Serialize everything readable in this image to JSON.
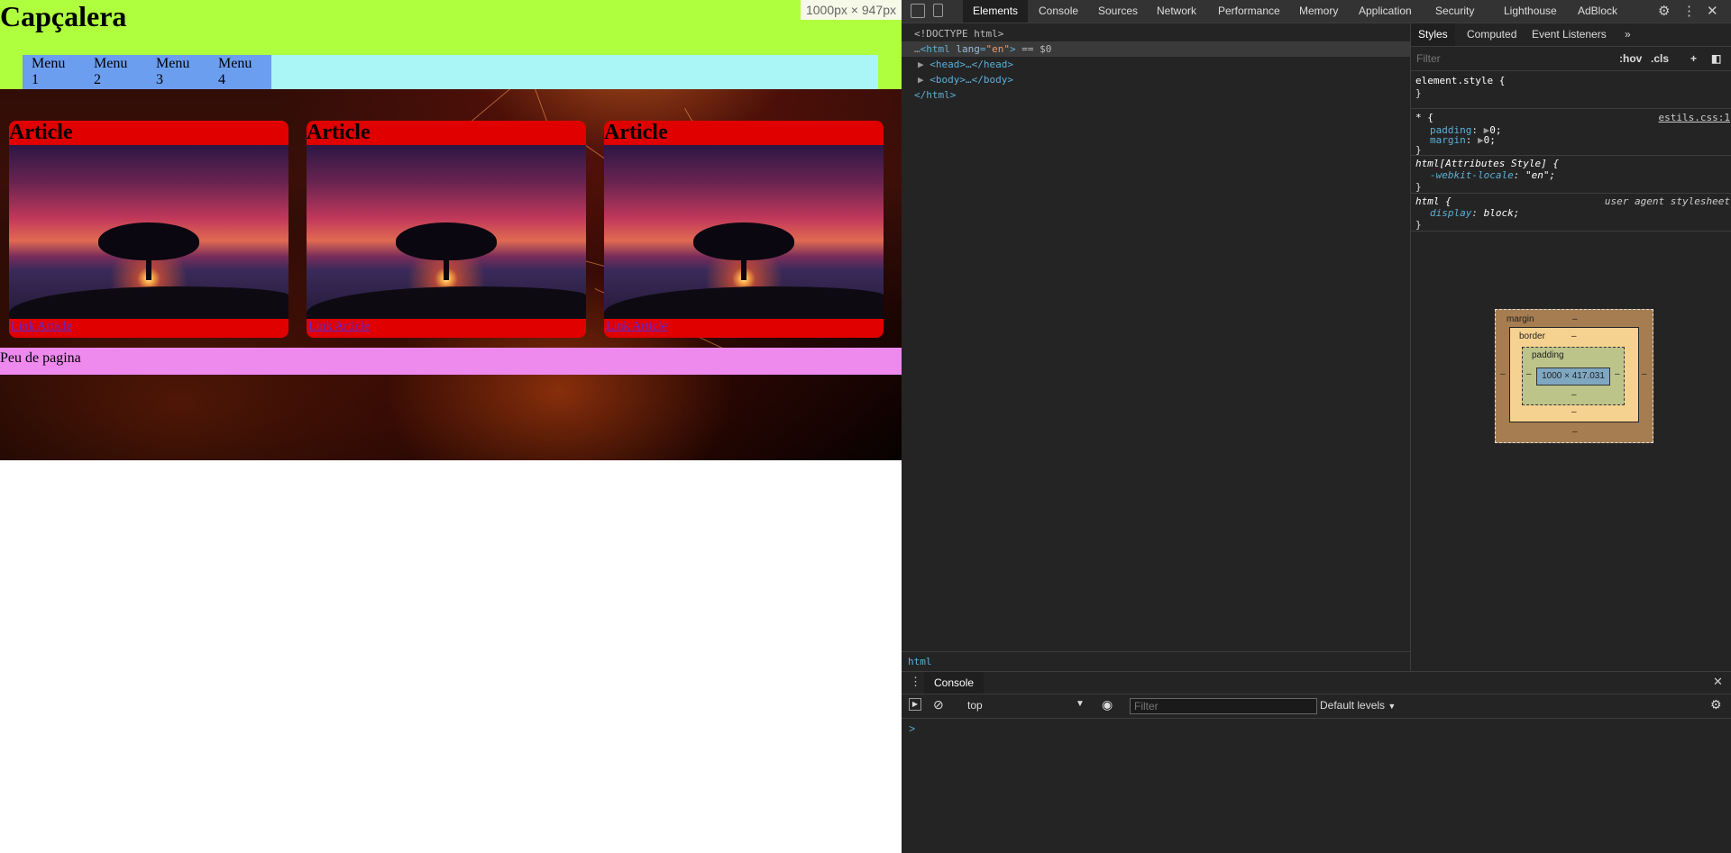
{
  "page": {
    "header_title": "Capçalera",
    "size_badge": "1000px × 947px",
    "menu": [
      "Menu 1",
      "Menu 2",
      "Menu 3",
      "Menu 4"
    ],
    "articles": [
      {
        "title": "Article",
        "link": "Link Article"
      },
      {
        "title": "Article",
        "link": "Link Article"
      },
      {
        "title": "Article",
        "link": "Link Article"
      }
    ],
    "footer": "Peu de pagina"
  },
  "devtools": {
    "tabs": [
      "Elements",
      "Console",
      "Sources",
      "Network",
      "Performance",
      "Memory",
      "Application",
      "Security",
      "Lighthouse",
      "AdBlock"
    ],
    "active_tab": "Elements",
    "dom": {
      "doctype": "<!DOCTYPE html>",
      "html_open": "<html",
      "lang_attr": "lang",
      "lang_val": "\"en\"",
      "html_close_tag": ">",
      "selected_marker": "== $0",
      "head": "<head>…</head>",
      "body": "<body>…</body>",
      "html_end": "</html>"
    },
    "breadcrumb": "html",
    "styles_tabs": [
      "Styles",
      "Computed",
      "Event Listeners"
    ],
    "styles_filter_placeholder": "Filter",
    "hov": ":hov",
    "cls": ".cls",
    "rules": {
      "element_style": "element.style {",
      "close": "}",
      "universal_selector": "* {",
      "universal_source": "estils.css:1",
      "padding_prop": "padding",
      "padding_val": "0;",
      "margin_prop": "margin",
      "margin_val": "0;",
      "attr_style_selector": "html[Attributes Style] {",
      "locale_prop": "-webkit-locale",
      "locale_val": "\"en\";",
      "html_selector": "html {",
      "ua_label": "user agent stylesheet",
      "display_prop": "display",
      "display_val": "block;"
    },
    "box_model": {
      "margin_label": "margin",
      "border_label": "border",
      "padding_label": "padding",
      "content_size": "1000 × 417.031",
      "dash": "–"
    },
    "drawer": {
      "tab": "Console",
      "context": "top",
      "filter_placeholder": "Filter",
      "levels": "Default levels",
      "prompt": ">"
    }
  }
}
